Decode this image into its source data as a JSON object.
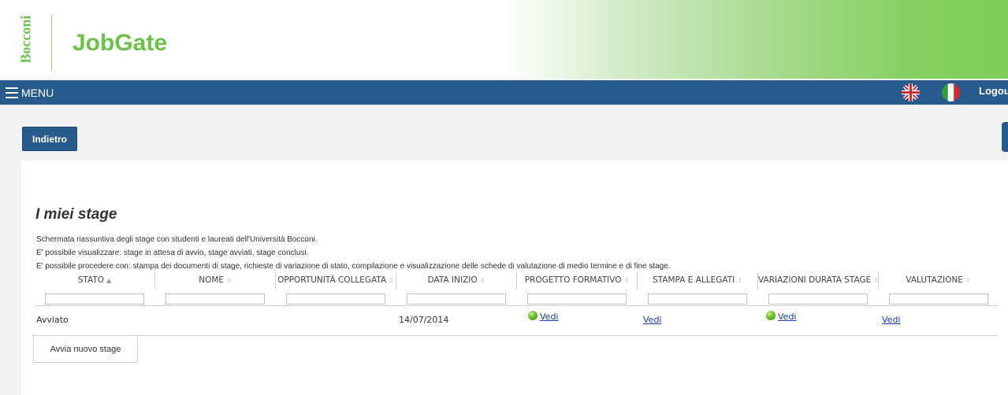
{
  "brand": {
    "logo_text": "Bocconi",
    "app_name": "JobGate"
  },
  "nav": {
    "menu_label": "MENU",
    "logout_label": "Logout",
    "lang_en_icon": "uk-flag-icon",
    "lang_it_icon": "italy-flag-icon"
  },
  "back_button": "Indietro",
  "page": {
    "title": "I miei stage",
    "desc1": "Schermata riassuntiva degli stage con studenti e laureati dell'Università Bocconi.",
    "desc2": "E' possibile visualizzare: stage in attesa di avvio, stage avviati, stage conclusi.",
    "desc3": "E' possibile procedere con: stampa dei documenti di stage, richieste di variazione di stato, compilazione e visualizzazione delle schede di valutazione di medio termine e di fine stage."
  },
  "table": {
    "columns": [
      "STATO",
      "NOME",
      "OPPORTUNITÀ COLLEGATA",
      "DATA INIZIO",
      "PROGETTO FORMATIVO",
      "STAMPA E ALLEGATI",
      "VARIAZIONI DURATA STAGE",
      "VALUTAZIONE"
    ],
    "sort_asc": "▲",
    "sort_both": "⇕",
    "rows": [
      {
        "stato": "Avviato",
        "nome": "",
        "opportunita": "",
        "data_inizio": "14/07/2014",
        "progetto": "Vedi",
        "stampa": "Vedi",
        "variazioni": "Vedi",
        "valutazione": "Vedi"
      }
    ]
  },
  "new_stage_button": "Avvia nuovo stage",
  "colors": {
    "brand_green": "#6cc24a",
    "nav_blue": "#265b8b",
    "link_blue": "#1a3fa8"
  }
}
